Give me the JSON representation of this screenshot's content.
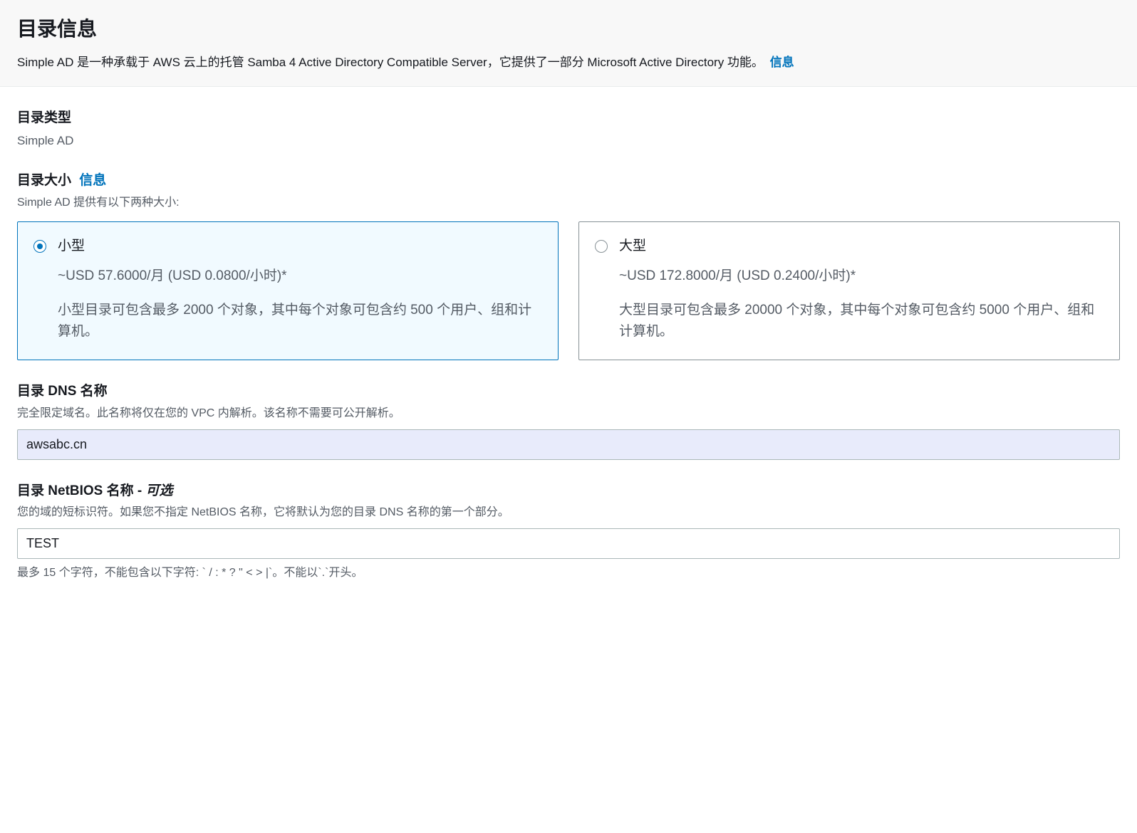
{
  "header": {
    "title": "目录信息",
    "description": "Simple AD 是一种承载于 AWS 云上的托管 Samba 4 Active Directory Compatible Server，它提供了一部分 Microsoft Active Directory 功能。",
    "info_link": "信息"
  },
  "directory_type": {
    "label": "目录类型",
    "value": "Simple AD"
  },
  "directory_size": {
    "label": "目录大小",
    "info_link": "信息",
    "helper": "Simple AD 提供有以下两种大小:",
    "options": [
      {
        "title": "小型",
        "price": "~USD 57.6000/月 (USD 0.0800/小时)*",
        "description": "小型目录可包含最多 2000 个对象，其中每个对象可包含约 500 个用户、组和计算机。",
        "selected": true
      },
      {
        "title": "大型",
        "price": "~USD 172.8000/月 (USD 0.2400/小时)*",
        "description": "大型目录可包含最多 20000 个对象，其中每个对象可包含约 5000 个用户、组和计算机。",
        "selected": false
      }
    ]
  },
  "dns_name": {
    "label": "目录 DNS 名称",
    "helper": "完全限定域名。此名称将仅在您的 VPC 内解析。该名称不需要可公开解析。",
    "value": "awsabc.cn"
  },
  "netbios_name": {
    "label": "目录 NetBIOS 名称 - ",
    "optional_suffix": "可选",
    "helper": "您的域的短标识符。如果您不指定 NetBIOS 名称，它将默认为您的目录 DNS 名称的第一个部分。",
    "value": "TEST",
    "constraint": "最多 15 个字符，不能包含以下字符: ` / : * ? \" < > |`。不能以`.`开头。"
  }
}
